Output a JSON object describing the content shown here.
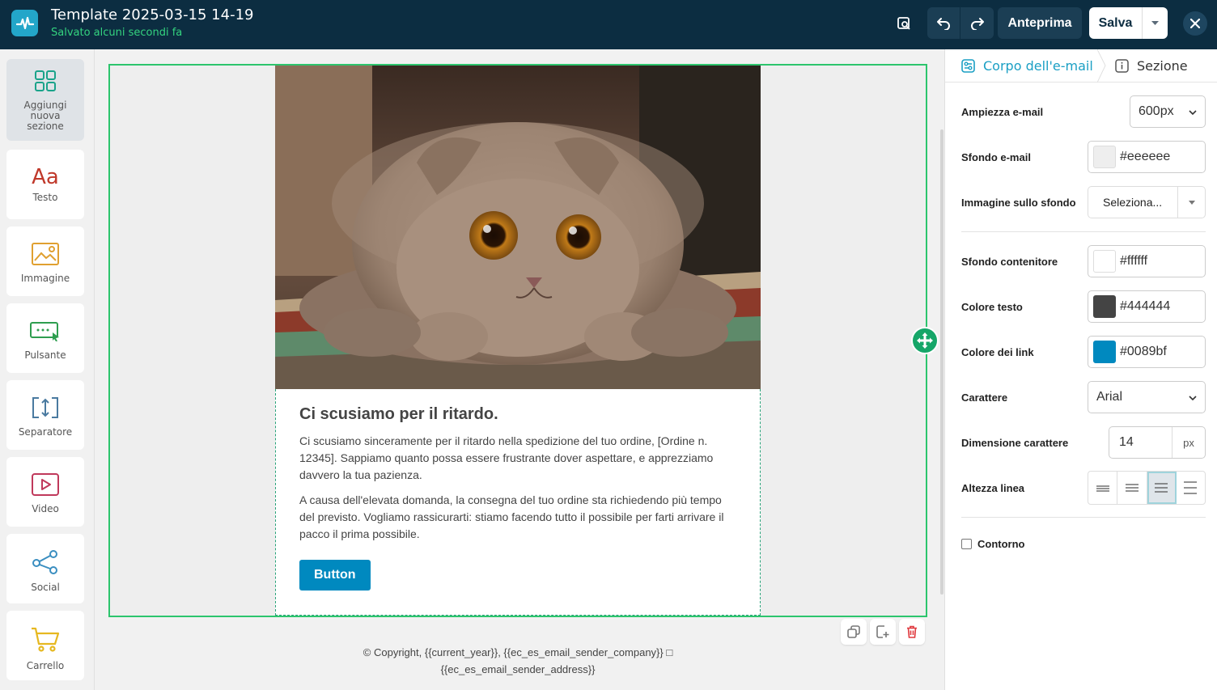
{
  "header": {
    "title": "Template 2025-03-15 14-19",
    "status": "Salvato alcuni secondi fa",
    "preview_label": "Anteprima",
    "save_label": "Salva"
  },
  "tools": [
    {
      "label": "Aggiungi nuova sezione",
      "icon": "grid-icon"
    },
    {
      "label": "Testo",
      "icon": "text-icon"
    },
    {
      "label": "Immagine",
      "icon": "image-icon"
    },
    {
      "label": "Pulsante",
      "icon": "button-icon"
    },
    {
      "label": "Separatore",
      "icon": "separator-icon"
    },
    {
      "label": "Video",
      "icon": "video-icon"
    },
    {
      "label": "Social",
      "icon": "share-icon"
    },
    {
      "label": "Carrello",
      "icon": "cart-icon"
    }
  ],
  "email": {
    "heading": "Ci scusiamo per il ritardo.",
    "para1": "Ci scusiamo sinceramente per il ritardo nella spedizione del tuo ordine, [Ordine n. 12345]. Sappiamo quanto possa essere frustrante dover aspettare, e apprezziamo davvero la tua pazienza.",
    "para2": "A causa dell'elevata domanda, la consegna del tuo ordine sta richiedendo più tempo del previsto. Vogliamo rassicurarti: stiamo facendo tutto il possibile per farti arrivare il pacco il prima possibile.",
    "button_label": "Button",
    "footer_line1": "© Copyright, {{current_year}}, {{ec_es_email_sender_company}} □",
    "footer_line2": "{{ec_es_email_sender_address}}"
  },
  "panel": {
    "tab_body": "Corpo dell'e-mail",
    "tab_section": "Sezione",
    "width_label": "Ampiezza e-mail",
    "width_value": "600px",
    "bg_label": "Sfondo e-mail",
    "bg_value": "#eeeeee",
    "bgimg_label": "Immagine sullo sfondo",
    "bgimg_value": "Seleziona...",
    "container_label": "Sfondo contenitore",
    "container_value": "#ffffff",
    "text_color_label": "Colore testo",
    "text_color_value": "#444444",
    "link_color_label": "Colore dei link",
    "link_color_value": "#0089bf",
    "font_label": "Carattere",
    "font_value": "Arial",
    "font_size_label": "Dimensione carattere",
    "font_size_value": "14",
    "font_size_unit": "px",
    "line_height_label": "Altezza linea",
    "border_label": "Contorno"
  },
  "colors": {
    "accent": "#1a9fc4",
    "header_bg": "#0c2d41",
    "frame": "#2cc56d",
    "button": "#0089bf"
  }
}
